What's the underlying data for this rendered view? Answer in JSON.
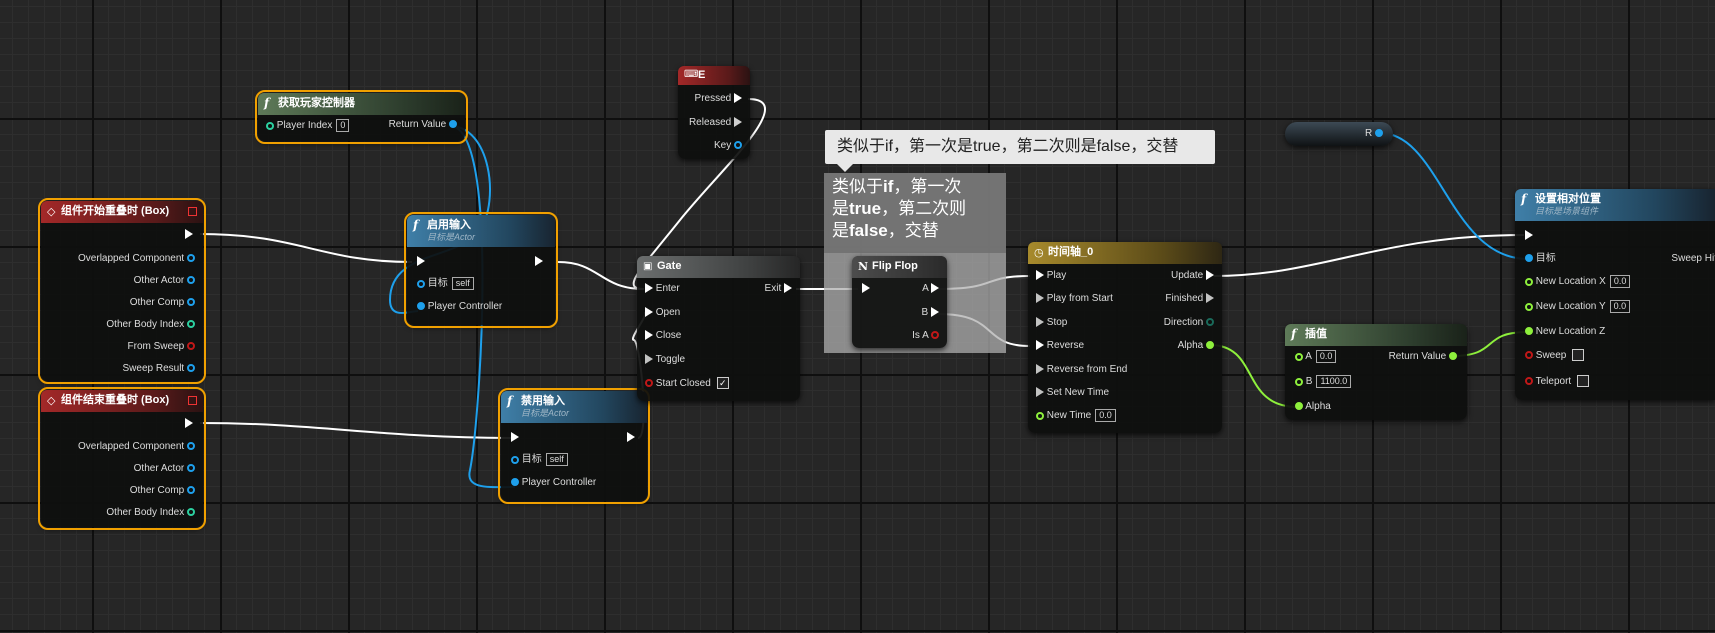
{
  "nodes": {
    "get_player_controller": {
      "title": "获取玩家控制器",
      "player_index_label": "Player Index",
      "player_index_value": "0",
      "return_value_label": "Return Value"
    },
    "begin_overlap": {
      "title": "组件开始重叠时 (Box)",
      "pins": [
        "Overlapped Component",
        "Other Actor",
        "Other Comp",
        "Other Body Index",
        "From Sweep",
        "Sweep Result"
      ]
    },
    "end_overlap": {
      "title": "组件结束重叠时 (Box)",
      "pins": [
        "Overlapped Component",
        "Other Actor",
        "Other Comp",
        "Other Body Index"
      ]
    },
    "enable_input": {
      "title": "启用输入",
      "subtitle": "目标是Actor",
      "target_label": "目标",
      "target_value": "self",
      "controller_label": "Player Controller"
    },
    "disable_input": {
      "title": "禁用输入",
      "subtitle": "目标是Actor",
      "target_label": "目标",
      "target_value": "self",
      "controller_label": "Player Controller"
    },
    "key_e": {
      "title": "E",
      "pressed": "Pressed",
      "released": "Released",
      "key": "Key"
    },
    "gate": {
      "title": "Gate",
      "enter": "Enter",
      "open": "Open",
      "close": "Close",
      "toggle": "Toggle",
      "start_closed": "Start Closed",
      "exit": "Exit",
      "start_closed_checked": "✓"
    },
    "flip_flop": {
      "title": "Flip Flop",
      "a": "A",
      "b": "B",
      "is_a": "Is A"
    },
    "timeline": {
      "title": "时间轴_0",
      "inputs": [
        "Play",
        "Play from Start",
        "Stop",
        "Reverse",
        "Reverse from End",
        "Set New Time"
      ],
      "new_time_label": "New Time",
      "new_time_value": "0.0",
      "outputs": [
        "Update",
        "Finished",
        "Direction",
        "Alpha"
      ]
    },
    "lerp": {
      "title": "插值",
      "a_label": "A",
      "a_value": "0.0",
      "b_label": "B",
      "b_value": "1100.0",
      "alpha_label": "Alpha",
      "return_label": "Return Value"
    },
    "r_var": {
      "label": "R"
    },
    "set_relative_location": {
      "title": "设置相对位置",
      "subtitle": "目标是场景组件",
      "target_label": "目标",
      "sweep_hit": "Sweep Hit",
      "loc_x_label": "New Location X",
      "loc_x_value": "0.0",
      "loc_y_label": "New Location Y",
      "loc_y_value": "0.0",
      "loc_z_label": "New Location Z",
      "sweep_label": "Sweep",
      "teleport_label": "Teleport"
    }
  },
  "comment_bubble": "类似于if，第一次是true，第二次则是false，交替",
  "comment_box": {
    "line1a": "类似于",
    "line1b": "if",
    "line1c": "，第一次",
    "line2a": "是",
    "line2b": "true",
    "line2c": "，第二次则",
    "line3a": "是",
    "line3b": "false",
    "line3c": "，交替"
  },
  "colors": {
    "exec": "#ffffff",
    "object": "#1ea0ec",
    "int": "#2cd0a0",
    "float": "#8ef03c",
    "bool": "#c01818",
    "selection": "#f0a000"
  }
}
